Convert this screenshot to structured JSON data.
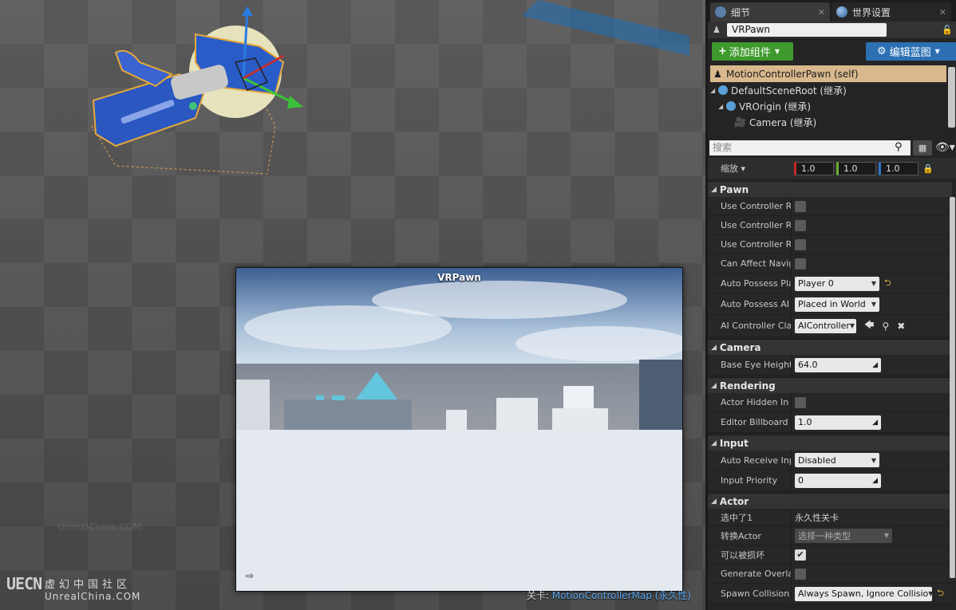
{
  "viewport": {
    "pip_title": "VRPawn",
    "level_prefix": "关卡:",
    "level_name": "MotionControllerMap (永久性)"
  },
  "watermark": {
    "logo": "UECN",
    "cn": "虚幻中国社区",
    "en": "UnrealChina.COM",
    "faint": "UnrealChina.COM"
  },
  "tabs": [
    {
      "label": "细节",
      "icon": "details-icon"
    },
    {
      "label": "世界设置",
      "icon": "world-icon"
    }
  ],
  "actor_name": "VRPawn",
  "buttons": {
    "add_component": "添加组件",
    "edit_blueprint": "编辑蓝图"
  },
  "tree": [
    {
      "label": "MotionControllerPawn (self)",
      "selected": true
    },
    {
      "label": "DefaultSceneRoot (继承)"
    },
    {
      "label": "VROrigin (继承)"
    },
    {
      "label": "Camera (继承)"
    }
  ],
  "search": {
    "placeholder": "搜索"
  },
  "scale": {
    "label": "缩放",
    "x": "1.0",
    "y": "1.0",
    "z": "1.0"
  },
  "categories": {
    "pawn": {
      "title": "Pawn",
      "rows": [
        {
          "label": "Use Controller Ro",
          "type": "checkbox"
        },
        {
          "label": "Use Controller Ro",
          "type": "checkbox"
        },
        {
          "label": "Use Controller Ro",
          "type": "checkbox"
        },
        {
          "label": "Can Affect Naviga",
          "type": "checkbox"
        },
        {
          "label": "Auto Possess Pla",
          "value": "Player 0"
        },
        {
          "label": "Auto Possess AI",
          "value": "Placed in World"
        },
        {
          "label": "AI Controller Clas",
          "value": "AIController"
        }
      ]
    },
    "camera": {
      "title": "Camera",
      "rows": [
        {
          "label": "Base Eye Height",
          "value": "64.0"
        }
      ]
    },
    "rendering": {
      "title": "Rendering",
      "rows": [
        {
          "label": "Actor Hidden In G",
          "type": "checkbox"
        },
        {
          "label": "Editor Billboard S",
          "value": "1.0"
        }
      ]
    },
    "input": {
      "title": "Input",
      "rows": [
        {
          "label": "Auto Receive Inpu",
          "value": "Disabled"
        },
        {
          "label": "Input Priority",
          "value": "0"
        }
      ]
    },
    "actor": {
      "title": "Actor",
      "rows": [
        {
          "label": "选中了1",
          "value": "永久性关卡"
        },
        {
          "label": "转换Actor",
          "value": "选择一种类型"
        },
        {
          "label": "可以被损坏",
          "checked": true
        },
        {
          "label": "Generate Overlap",
          "type": "checkbox"
        },
        {
          "label": "Spawn Collision H",
          "value": "Always Spawn, Ignore Collisio"
        }
      ]
    }
  },
  "colors": {
    "add_component": "#3f9a2e",
    "edit_blueprint": "#2c6fb3",
    "selected_row": "#d8b88c",
    "level_link": "#5aa8f0"
  }
}
